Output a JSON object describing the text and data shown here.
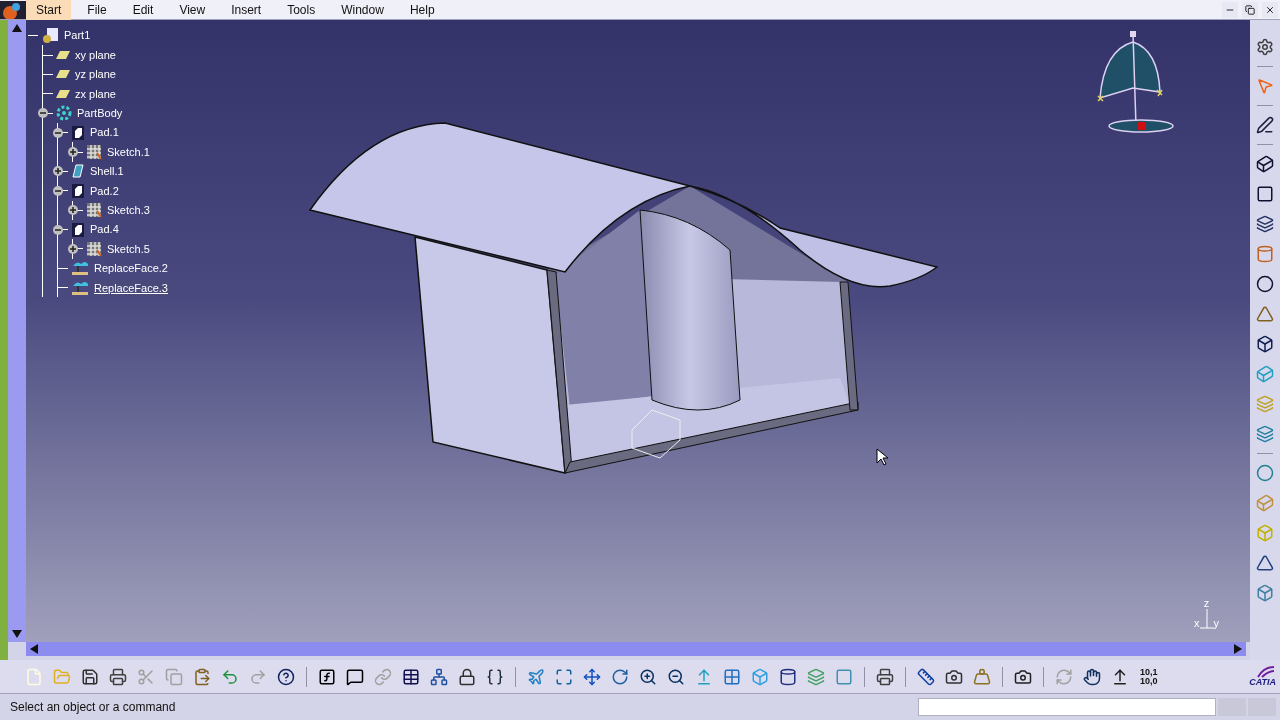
{
  "menu": [
    {
      "label": "Start",
      "selected": true
    },
    {
      "label": "File",
      "selected": false
    },
    {
      "label": "Edit",
      "selected": false
    },
    {
      "label": "View",
      "selected": false
    },
    {
      "label": "Insert",
      "selected": false
    },
    {
      "label": "Tools",
      "selected": false
    },
    {
      "label": "Window",
      "selected": false
    },
    {
      "label": "Help",
      "selected": false
    }
  ],
  "tree": {
    "label": "Part1",
    "kind": "part",
    "selected": false,
    "children": [
      {
        "label": "xy plane",
        "kind": "plane",
        "selected": false
      },
      {
        "label": "yz plane",
        "kind": "plane",
        "selected": false
      },
      {
        "label": "zx plane",
        "kind": "plane",
        "selected": false
      },
      {
        "label": "PartBody",
        "kind": "body",
        "selected": false,
        "expanded": true,
        "children": [
          {
            "label": "Pad.1",
            "kind": "pad",
            "selected": false,
            "expanded": true,
            "children": [
              {
                "label": "Sketch.1",
                "kind": "sketch",
                "selected": false,
                "expanded": false
              }
            ]
          },
          {
            "label": "Shell.1",
            "kind": "shell",
            "selected": false,
            "expanded": false
          },
          {
            "label": "Pad.2",
            "kind": "pad",
            "selected": false,
            "expanded": true,
            "children": [
              {
                "label": "Sketch.3",
                "kind": "sketch",
                "selected": false,
                "expanded": false
              }
            ]
          },
          {
            "label": "Pad.4",
            "kind": "pad",
            "selected": false,
            "expanded": true,
            "children": [
              {
                "label": "Sketch.5",
                "kind": "sketch",
                "selected": false,
                "expanded": false
              }
            ]
          },
          {
            "label": "ReplaceFace.2",
            "kind": "replace",
            "selected": false
          },
          {
            "label": "ReplaceFace.3",
            "kind": "replace",
            "selected": true
          }
        ]
      }
    ]
  },
  "triad": {
    "z": "z",
    "x": "x",
    "y": "y"
  },
  "toolbar": {
    "grid_text": [
      "10,1",
      "10,0"
    ],
    "logo": "CATIA"
  },
  "status_bar": {
    "message": "Select an object or a command"
  }
}
